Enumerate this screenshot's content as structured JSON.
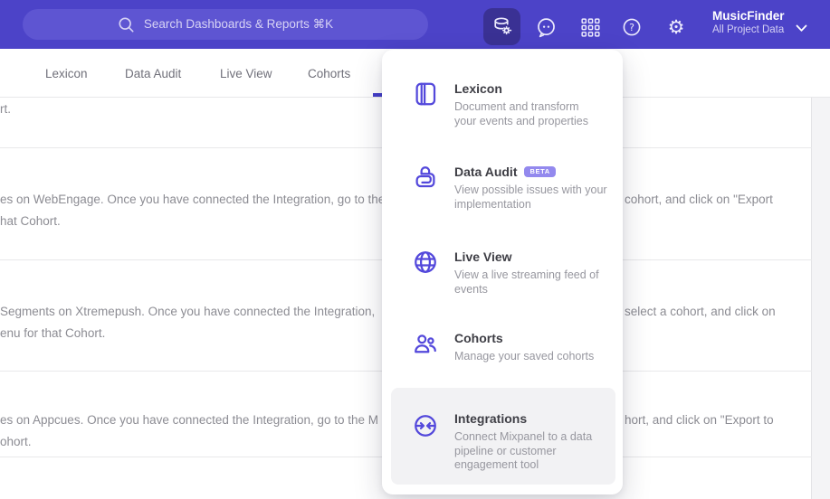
{
  "colors": {
    "topbar": "#4C43C8",
    "topbar_active_tile": "#3A3194",
    "accent_purple": "#5348DB",
    "beta_badge": "#9389EE",
    "tab_underline": "#443EC9"
  },
  "topbar": {
    "search": {
      "text": "Search Dashboards & Reports ⌘K"
    },
    "project": {
      "name": "MusicFinder",
      "subtitle": "All Project Data"
    }
  },
  "tabs": {
    "items": [
      {
        "label": "Lexicon"
      },
      {
        "label": "Data Audit"
      },
      {
        "label": "Live View"
      },
      {
        "label": "Cohorts"
      }
    ]
  },
  "menu": {
    "items": [
      {
        "title": "Lexicon",
        "description": "Document and transform\nyour events and properties"
      },
      {
        "title": "Data Audit",
        "badge": "BETA",
        "description": "View possible issues with your\nimplementation"
      },
      {
        "title": "Live View",
        "description": "View a live streaming feed of\nevents"
      },
      {
        "title": "Cohorts",
        "description": "Manage your saved cohorts"
      },
      {
        "title": "Integrations",
        "description": "Connect Mixpanel to a data\npipeline or customer\nengagement tool"
      }
    ]
  },
  "content": {
    "row1": {
      "left": "rt."
    },
    "row2": {
      "left": "es on WebEngage. Once you have connected the Integration, go to the\nhat Cohort.",
      "right": "cohort, and click on \"Export"
    },
    "row3": {
      "left": "Segments on Xtremepush. Once you have connected the Integration,\nenu for that Cohort.",
      "right": "select a cohort, and click on"
    },
    "row4": {
      "left": "es on Appcues. Once you have connected the Integration, go to the M\nohort.",
      "right": "hort, and click on \"Export to"
    }
  }
}
